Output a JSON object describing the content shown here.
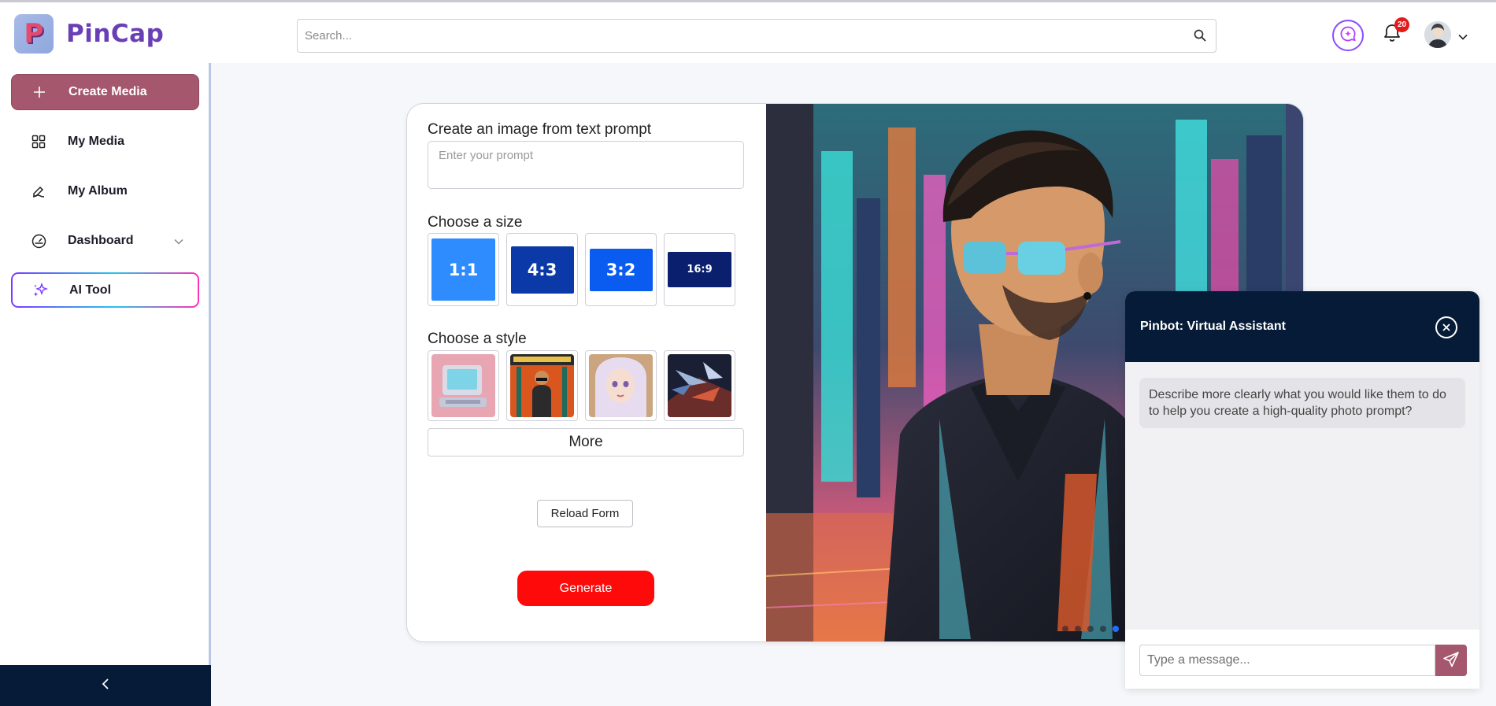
{
  "app": {
    "logo_letter": "P",
    "name": "PinCap"
  },
  "search": {
    "placeholder": "Search...",
    "icon": "search-icon"
  },
  "header": {
    "chat_icon": "chat-sparkle-icon",
    "notifications_count": "20",
    "notifications_icon": "bell-icon",
    "avatar_icon": "avatar",
    "menu_caret_icon": "chevron-down-icon"
  },
  "sidebar": {
    "items": [
      {
        "label": "Create Media",
        "icon": "plus-icon"
      },
      {
        "label": "My Media",
        "icon": "grid-icon"
      },
      {
        "label": "My Album",
        "icon": "pen-icon"
      },
      {
        "label": "Dashboard",
        "icon": "gauge-icon"
      },
      {
        "label": "AI Tool",
        "icon": "sparkles-icon"
      }
    ],
    "collapse_icon": "chevron-left-icon"
  },
  "form": {
    "prompt_label": "Create an image from text prompt",
    "prompt_placeholder": "Enter your prompt",
    "size_label": "Choose a size",
    "sizes": [
      "1:1",
      "4:3",
      "3:2",
      "16:9"
    ],
    "style_label": "Choose a style",
    "styles": [
      "retro-computer",
      "poster-figure",
      "anime-portrait",
      "abstract-shards"
    ],
    "more_label": "More",
    "reload_label": "Reload Form",
    "generate_label": "Generate"
  },
  "preview": {
    "slides": 1,
    "active_slide": 1
  },
  "colors": {
    "primary": "#a4576d",
    "navy": "#061b38",
    "generate": "#ff0a0a",
    "size_1_1": "#2f8cff",
    "size_4_3": "#0b3aa8",
    "size_3_2": "#0a5cf0",
    "size_16_9": "#0a1f6e"
  },
  "chat": {
    "title": "Pinbot: Virtual Assistant",
    "close_icon": "close-icon",
    "messages": [
      {
        "from": "bot",
        "text": "Describe more clearly what you would like them to do to help you create a high-quality photo prompt?"
      }
    ],
    "input_placeholder": "Type a message...",
    "send_icon": "send-icon"
  }
}
